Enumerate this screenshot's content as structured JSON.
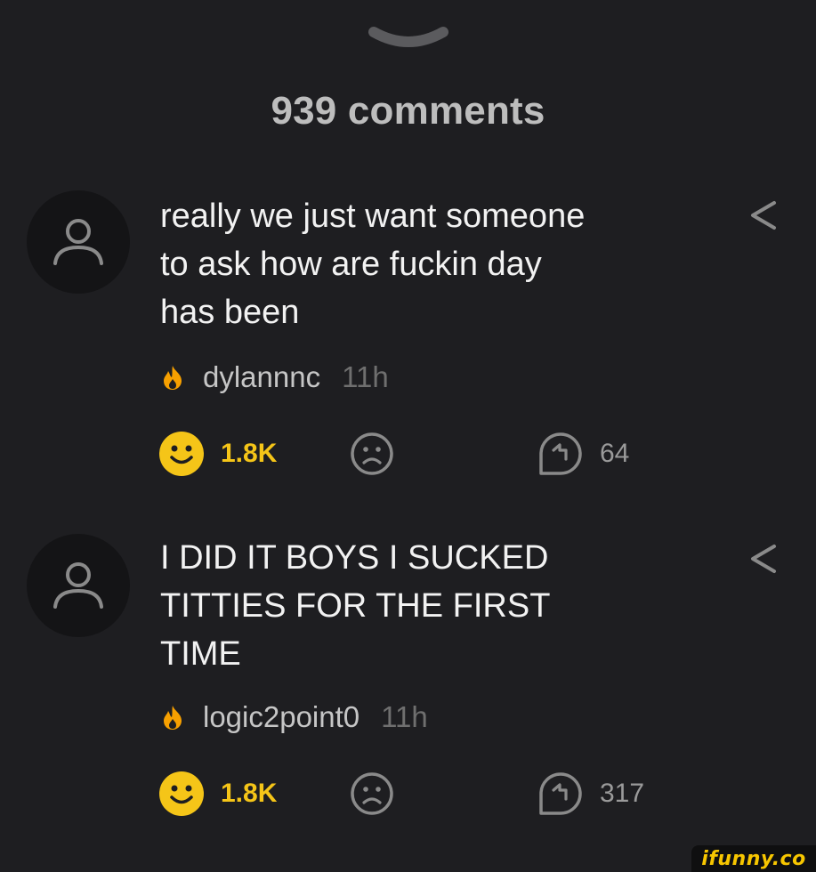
{
  "header": {
    "comment_count": "939 comments"
  },
  "comments": [
    {
      "text_lines": [
        "really we just want someone",
        "to ask how are fuckin day",
        "has been"
      ],
      "author": "dylannnc",
      "time": "11h",
      "likes": "1.8K",
      "replies": "64"
    },
    {
      "text_lines": [
        "I DID IT BOYS I SUCKED",
        "TITTIES FOR THE FIRST",
        "TIME"
      ],
      "author": "logic2point0",
      "time": "11h",
      "likes": "1.8K",
      "replies": "317"
    }
  ],
  "watermark": {
    "label": "ifunny.co"
  },
  "colors": {
    "background": "#1e1e21",
    "accent": "#f5c518",
    "flame": "#f7a000"
  },
  "icons": [
    "chevron-down-icon",
    "user-icon",
    "share-icon",
    "flame-icon",
    "smile-icon",
    "frown-icon",
    "reply-icon"
  ]
}
